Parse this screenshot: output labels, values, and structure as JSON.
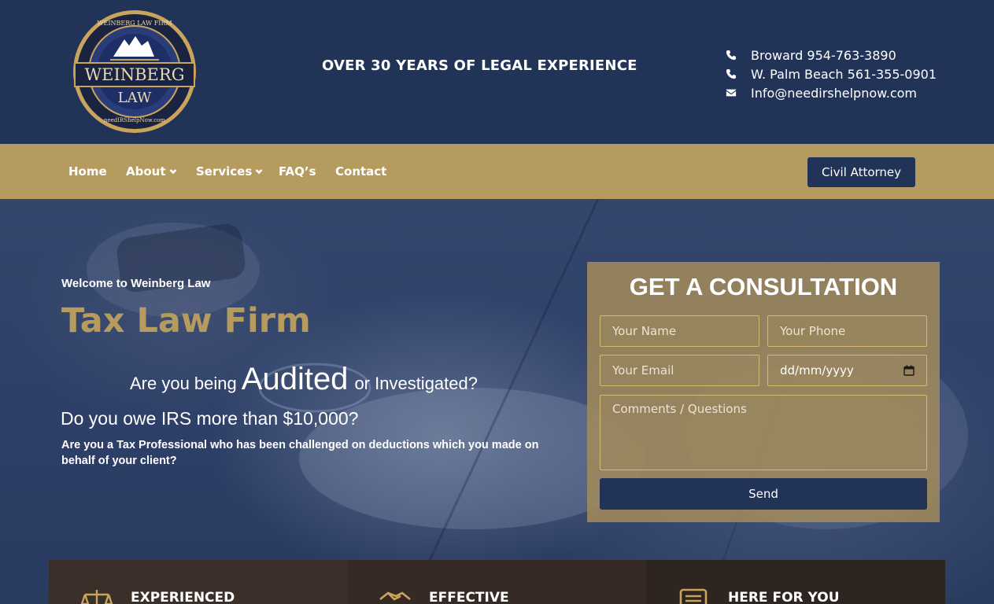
{
  "header": {
    "logo_text": {
      "ring": "WEINBERG LAW FIRM",
      "line1": "WEINBERG",
      "line2": "LAW",
      "url": "needIRShelpNow.com"
    },
    "tagline": "OVER 30 YEARS OF LEGAL EXPERIENCE",
    "contacts": [
      {
        "icon": "phone-icon",
        "text": "Broward 954-763-3890"
      },
      {
        "icon": "phone-icon",
        "text": "W. Palm Beach 561-355-0901"
      },
      {
        "icon": "envelope-icon",
        "text": "Info@needirshelpnow.com"
      }
    ]
  },
  "nav": {
    "items": [
      {
        "label": "Home",
        "has_dropdown": false
      },
      {
        "label": "About",
        "has_dropdown": true
      },
      {
        "label": "Services",
        "has_dropdown": true
      },
      {
        "label": "FAQ’s",
        "has_dropdown": false
      },
      {
        "label": "Contact",
        "has_dropdown": false
      }
    ],
    "cta_label": "Civil Attorney"
  },
  "hero": {
    "welcome": "Welcome to Weinberg Law",
    "title": "Tax Law Firm",
    "question1": {
      "before": "Are you being",
      "emphasis": "Audited",
      "after": "or Investigated?"
    },
    "question2": "Do you owe IRS more than $10,000?",
    "question3": "Are you a Tax Professional who has been challenged on deductions which you made on behalf of your client?"
  },
  "form": {
    "title": "GET A CONSULTATION",
    "name_placeholder": "Your Name",
    "phone_placeholder": "Your Phone",
    "email_placeholder": "Your Email",
    "date_placeholder": "dd/mm/yyyy",
    "comments_placeholder": "Comments / Questions",
    "send_label": "Send"
  },
  "features": [
    {
      "icon": "scales-icon",
      "label": "EXPERIENCED"
    },
    {
      "icon": "handshake-icon",
      "label": "EFFECTIVE"
    },
    {
      "icon": "document-icon",
      "label": "HERE FOR YOU"
    }
  ],
  "colors": {
    "navy": "#223358",
    "gold": "#b69b5f",
    "form_bg": "#a08a5c",
    "field_border": "#d6bb6e",
    "feature_bg": "#3a2f27"
  }
}
